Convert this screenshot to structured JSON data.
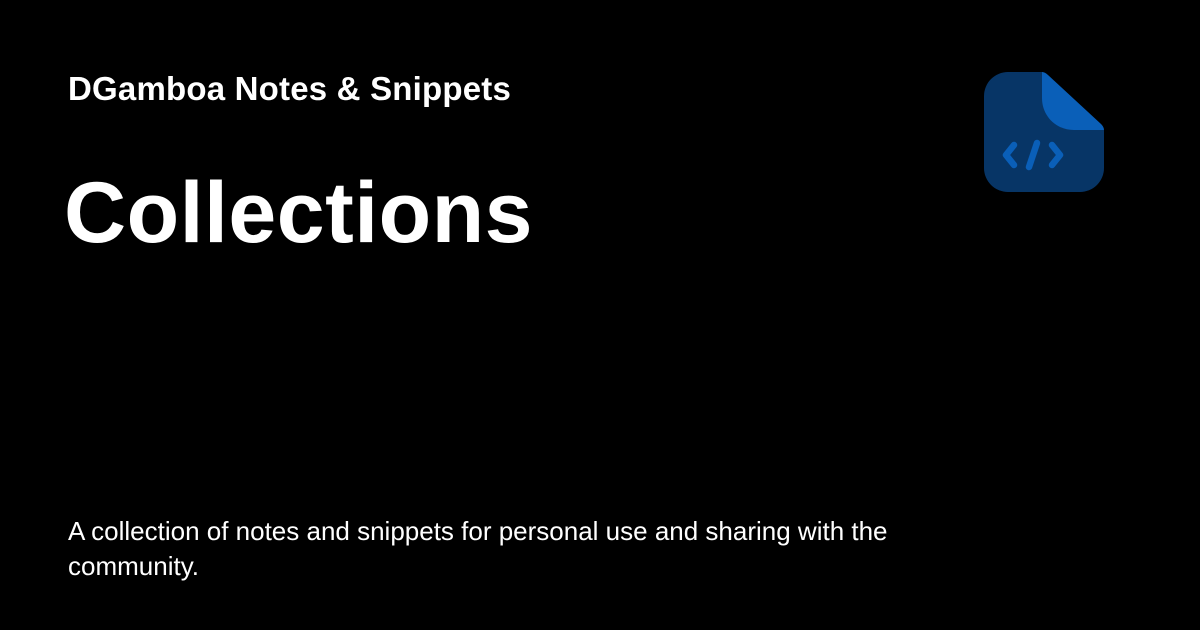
{
  "site": {
    "name": "DGamboa Notes & Snippets"
  },
  "page": {
    "title": "Collections",
    "description": "A collection of notes and snippets for personal use and sharing with the community."
  },
  "logo": {
    "icon": "code-file-icon",
    "colors": {
      "body": "#073566",
      "fold": "#0a5fb8",
      "glyph": "#0a5fb8"
    }
  },
  "colors": {
    "background": "#000000",
    "text": "#ffffff"
  }
}
